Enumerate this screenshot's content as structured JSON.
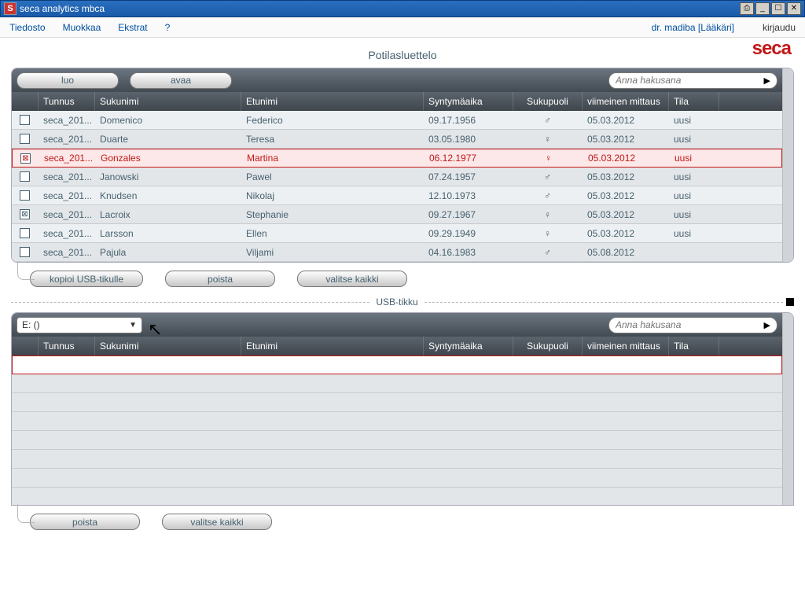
{
  "window": {
    "title": "seca analytics mbca",
    "buttons": [
      "⎙",
      "_",
      "☐",
      "✕"
    ]
  },
  "menu": {
    "items": [
      "Tiedosto",
      "Muokkaa",
      "Ekstrat",
      "?"
    ],
    "user": "dr. madiba [Lääkäri]",
    "login": "kirjaudu"
  },
  "logo": "seca",
  "page_title": "Potilasluettelo",
  "top": {
    "buttons": [
      "luo",
      "avaa"
    ],
    "search_placeholder": "Anna hakusana",
    "columns": [
      "",
      "Tunnus",
      "Sukunimi",
      "Etunimi",
      "Syntymäaika",
      "Sukupuoli",
      "viimeinen mittaus",
      "Tila"
    ],
    "rows": [
      {
        "chk": "",
        "id": "seca_201...",
        "ln": "Domenico",
        "fn": "Federico",
        "dob": "09.17.1956",
        "sex": "♂",
        "lm": "05.03.2012",
        "st": "uusi",
        "sel": false
      },
      {
        "chk": "",
        "id": "seca_201...",
        "ln": "Duarte",
        "fn": "Teresa",
        "dob": "03.05.1980",
        "sex": "♀",
        "lm": "05.03.2012",
        "st": "uusi",
        "sel": false
      },
      {
        "chk": "⊠",
        "id": "seca_201...",
        "ln": "Gonzales",
        "fn": "Martina",
        "dob": "06.12.1977",
        "sex": "♀",
        "lm": "05.03.2012",
        "st": "uusi",
        "sel": true
      },
      {
        "chk": "",
        "id": "seca_201...",
        "ln": "Janowski",
        "fn": "Pawel",
        "dob": "07.24.1957",
        "sex": "♂",
        "lm": "05.03.2012",
        "st": "uusi",
        "sel": false
      },
      {
        "chk": "",
        "id": "seca_201...",
        "ln": "Knudsen",
        "fn": "Nikolaj",
        "dob": "12.10.1973",
        "sex": "♂",
        "lm": "05.03.2012",
        "st": "uusi",
        "sel": false
      },
      {
        "chk": "⊠",
        "id": "seca_201...",
        "ln": "Lacroix",
        "fn": "Stephanie",
        "dob": "09.27.1967",
        "sex": "♀",
        "lm": "05.03.2012",
        "st": "uusi",
        "sel": false
      },
      {
        "chk": "",
        "id": "seca_201...",
        "ln": "Larsson",
        "fn": "Ellen",
        "dob": "09.29.1949",
        "sex": "♀",
        "lm": "05.03.2012",
        "st": "uusi",
        "sel": false
      },
      {
        "chk": "",
        "id": "seca_201...",
        "ln": "Pajula",
        "fn": "Viljami",
        "dob": "04.16.1983",
        "sex": "♂",
        "lm": "05.08.2012",
        "st": "",
        "sel": false
      }
    ],
    "actions": [
      "kopioi USB-tikulle",
      "poista",
      "valitse kaikki"
    ]
  },
  "divider": "USB-tikku",
  "usb": {
    "drive": "E: ()",
    "search_placeholder": "Anna hakusana",
    "columns": [
      "",
      "Tunnus",
      "Sukunimi",
      "Etunimi",
      "Syntymäaika",
      "Sukupuoli",
      "viimeinen mittaus",
      "Tila"
    ],
    "actions": [
      "poista",
      "valitse kaikki"
    ]
  }
}
